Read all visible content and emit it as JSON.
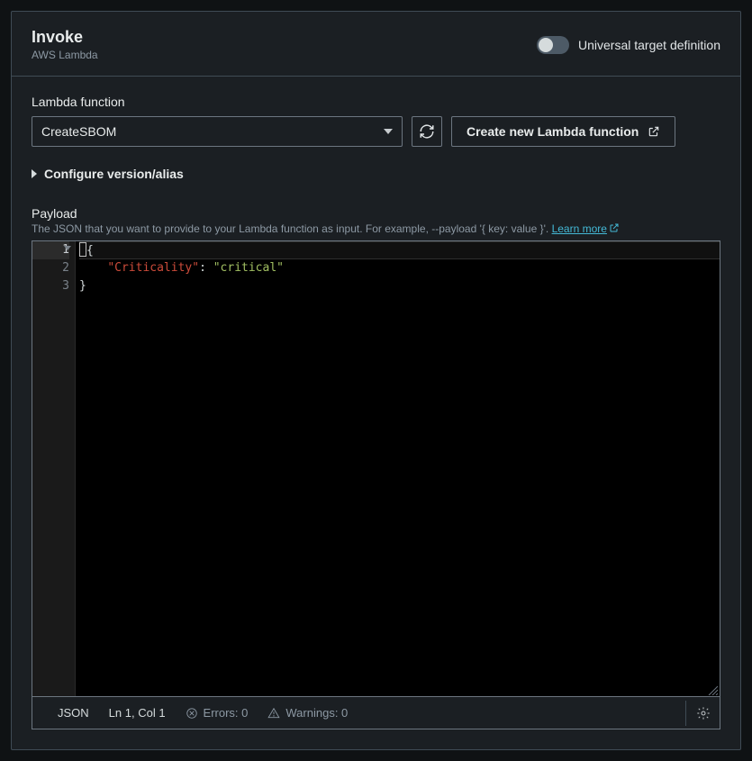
{
  "header": {
    "title": "Invoke",
    "subtitle": "AWS Lambda",
    "toggle_label": "Universal target definition"
  },
  "lambda": {
    "section_label": "Lambda function",
    "selected_value": "CreateSBOM",
    "create_button": "Create new Lambda function"
  },
  "expander": {
    "label": "Configure version/alias"
  },
  "payload": {
    "title": "Payload",
    "desc_prefix": "The JSON that you want to provide to your Lambda function as input. For example, --payload '{ key: value }'. ",
    "learn_more": "Learn more"
  },
  "editor": {
    "lines": {
      "l1": "{",
      "l2_key": "\"Criticality\"",
      "l2_val": "\"critical\"",
      "l3": "}"
    },
    "gutter": {
      "n1": "1",
      "n2": "2",
      "n3": "3"
    }
  },
  "statusbar": {
    "format": "JSON",
    "position": "Ln 1, Col 1",
    "errors_label": "Errors: 0",
    "warnings_label": "Warnings: 0"
  }
}
